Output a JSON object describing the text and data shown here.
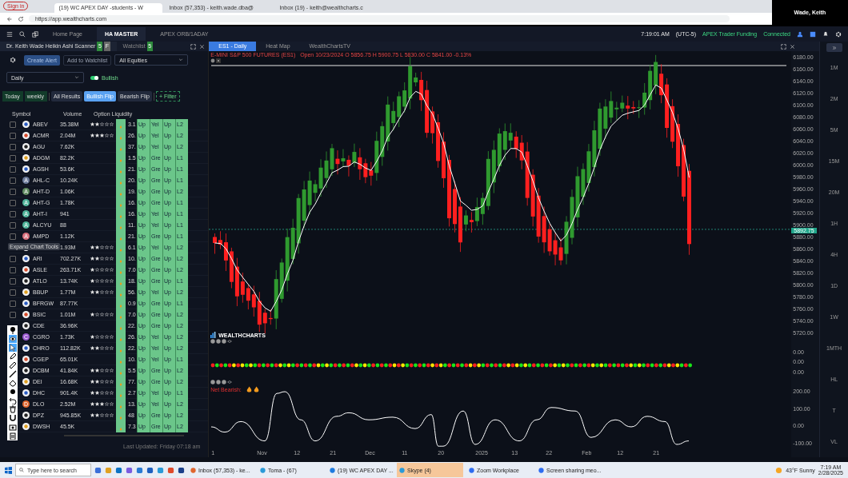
{
  "browser": {
    "sign_in": "Sign in",
    "tabs": [
      {
        "title": "(19) WC APEX DAY -students - W",
        "selected": true
      },
      {
        "title": "Inbox (57,353) - keith.wade.dba@",
        "selected": false
      },
      {
        "title": "Inbox (19) - keith@wealthcharts.c",
        "selected": false
      }
    ],
    "url": "https://app.wealthcharts.com"
  },
  "video_tile": {
    "name": "Wade, Keith"
  },
  "app_bar": {
    "tabs": [
      {
        "label": "Home Page",
        "selected": false
      },
      {
        "label": "HA MASTER",
        "selected": true
      },
      {
        "label": "APEX ORB/1ADAY",
        "selected": false
      }
    ],
    "time": "7:19:01 AM",
    "timezone": "(UTC-5)",
    "broker": "APEX Trader Funding",
    "status": "Connected"
  },
  "scanner": {
    "tabs": [
      {
        "label": "Dr. Keith Wade Heikin Ashi Scanner",
        "badges": [
          "5",
          "F"
        ],
        "selected": true
      },
      {
        "label": "Watchlist",
        "badges": [
          "5"
        ],
        "selected": false
      }
    ],
    "create_alert": "Create Alert",
    "add_watchlist": "Add to Watchlist",
    "universe": "All Equities",
    "timeframe": "Daily",
    "bullish": {
      "label": "Bullish",
      "on": true
    },
    "chips": [
      "Today",
      "weekly"
    ],
    "filters": [
      {
        "label": "All Results",
        "selected": false
      },
      {
        "label": "Bullish Flip",
        "selected": true
      },
      {
        "label": "Bearish Flip",
        "selected": false
      }
    ],
    "add_filter": "+ Filter",
    "columns": [
      "Symbol",
      "Volume",
      "Option Liquidity"
    ],
    "rows": [
      {
        "checked": false,
        "symbol": "ABEV",
        "volume": "35.38M",
        "stars": 2,
        "cells": [
          "3.1",
          "Up",
          "Yel",
          "Up",
          "L2"
        ]
      },
      {
        "checked": false,
        "symbol": "ACMR",
        "volume": "2.04M",
        "stars": 3,
        "cells": [
          "26.",
          "Up",
          "Yel",
          "Up",
          "L2"
        ]
      },
      {
        "checked": false,
        "symbol": "AGU",
        "volume": "7.62K",
        "cells": [
          "37.",
          "Up",
          "Yel",
          "Up",
          "L2"
        ]
      },
      {
        "checked": false,
        "symbol": "ADGM",
        "volume": "82.2K",
        "cells": [
          "1.5",
          "Up",
          "Gre",
          "Up",
          "L1"
        ]
      },
      {
        "checked": false,
        "symbol": "AGSH",
        "volume": "53.6K",
        "cells": [
          "21.",
          "Up",
          "Gre",
          "Up",
          "L1"
        ]
      },
      {
        "checked": false,
        "symbol": "AHL-C",
        "volume": "10.24K",
        "avatar": "A",
        "color": "#6b7a99",
        "cells": [
          "20.",
          "Up",
          "Gre",
          "Up",
          "L1"
        ]
      },
      {
        "checked": false,
        "symbol": "AHT-D",
        "volume": "1.06K",
        "avatar": "A",
        "color": "#5f8a5f",
        "cells": [
          "19.",
          "Up",
          "Gre",
          "Up",
          "L2"
        ]
      },
      {
        "checked": false,
        "symbol": "AHT-G",
        "volume": "1.78K",
        "avatar": "A",
        "color": "#4fb39a",
        "cells": [
          "16.",
          "Up",
          "Gre",
          "Up",
          "L1"
        ]
      },
      {
        "checked": false,
        "symbol": "AHT-I",
        "volume": "941",
        "avatar": "A",
        "color": "#4fb39a",
        "cells": [
          "16.",
          "Up",
          "Yel",
          "Up",
          "L1"
        ]
      },
      {
        "checked": false,
        "symbol": "ALCYU",
        "volume": "88",
        "avatar": "A",
        "color": "#4fb39a",
        "cells": [
          "11.",
          "Up",
          "Yel",
          "Up",
          "L1"
        ]
      },
      {
        "checked": false,
        "symbol": "AMPD",
        "volume": "1.12K",
        "avatar": "A",
        "color": "#d9707e",
        "cells": [
          "21.",
          "Up",
          "Gre",
          "Up",
          "L1"
        ]
      },
      {
        "volume": "1.93M",
        "stars": 2,
        "cells": [
          "6.1",
          "Up",
          "Yel",
          "Up",
          "L2"
        ]
      },
      {
        "checked": false,
        "symbol": "ARI",
        "volume": "702.27K",
        "stars": 2,
        "cells": [
          "10.",
          "Up",
          "Gre",
          "Up",
          "L2"
        ]
      },
      {
        "checked": false,
        "symbol": "ASLE",
        "volume": "263.71K",
        "stars": 1,
        "cells": [
          "7.0",
          "Up",
          "Gre",
          "Up",
          "L2"
        ]
      },
      {
        "checked": false,
        "symbol": "ATLO",
        "volume": "13.74K",
        "stars": 1,
        "cells": [
          "18.",
          "Up",
          "Gre",
          "Up",
          "L1"
        ]
      },
      {
        "checked": false,
        "symbol": "BBUP",
        "volume": "1.77M",
        "stars": 2,
        "cells": [
          "56.",
          "Up",
          "Yel",
          "Up",
          "L2"
        ]
      },
      {
        "checked": false,
        "symbol": "BFRGW",
        "volume": "87.77K",
        "cells": [
          "0.9",
          "Up",
          "Gre",
          "Up",
          "L1"
        ]
      },
      {
        "checked": false,
        "symbol": "BSIC",
        "volume": "1.01M",
        "stars": 1,
        "cells": [
          "7.0",
          "Up",
          "Gre",
          "Up",
          "L2"
        ]
      },
      {
        "symbol": "CDE",
        "volume": "36.96K",
        "cells": [
          "22.",
          "Up",
          "Gre",
          "Up",
          "L2"
        ]
      },
      {
        "symbol": "CGRO",
        "volume": "1.73K",
        "stars": 1,
        "avatar": "C",
        "color": "#9b59d0",
        "cells": [
          "26.",
          "Up",
          "Yel",
          "Up",
          "L2"
        ]
      },
      {
        "symbol": "CHRO",
        "volume": "112.82K",
        "stars": 2,
        "cells": [
          "22.",
          "Up",
          "Yel",
          "Up",
          "L2"
        ]
      },
      {
        "symbol": "CGEP",
        "volume": "65.01K",
        "cells": [
          "10.",
          "Up",
          "Yel",
          "Up",
          "L1"
        ]
      },
      {
        "symbol": "DCBM",
        "volume": "41.84K",
        "stars": 2,
        "cells": [
          "5.5",
          "Up",
          "Gre",
          "Up",
          "L2"
        ]
      },
      {
        "symbol": "DEI",
        "volume": "16.68K",
        "stars": 2,
        "cells": [
          "77.",
          "Up",
          "Gre",
          "Up",
          "L2"
        ]
      },
      {
        "symbol": "DHC",
        "volume": "901.4K",
        "stars": 2,
        "cells": [
          "2.7",
          "Up",
          "Yel",
          "Up",
          "L1"
        ]
      },
      {
        "symbol": "DLO",
        "volume": "2.52M",
        "stars": 3,
        "avatar": "D",
        "color": "#e0662e",
        "cells": [
          "13.",
          "Up",
          "Yel",
          "Up",
          "L2"
        ]
      },
      {
        "symbol": "DPZ",
        "volume": "945.85K",
        "stars": 2,
        "cells": [
          "48",
          "Up",
          "Gre",
          "Up",
          "L2"
        ]
      },
      {
        "symbol": "DWSH",
        "volume": "45.5K",
        "cells": [
          "7.3",
          "Up",
          "Gre",
          "Up",
          "L2"
        ]
      }
    ],
    "last_updated": "Last Updated: Friday 07:18 am"
  },
  "chart": {
    "tabs": [
      {
        "label": "ES1 - Daily",
        "selected": true
      },
      {
        "label": "Heat Map",
        "selected": false
      },
      {
        "label": "WealthChartsTV",
        "selected": false
      }
    ],
    "legend": "E-MINI S&P 500 FUTURES (ES1)   Open 10/23/2024 O 5856.75 H 5900.75 L 5830.00 C 5841.00 -0.13%",
    "price_labels": [
      "6180.00",
      "6160.00",
      "6140.00",
      "6120.00",
      "6100.00",
      "6080.00",
      "6060.00",
      "6040.00",
      "6020.00",
      "6000.00",
      "5980.00",
      "5960.00",
      "5940.00",
      "5920.00",
      "5900.00",
      "5880.00",
      "5860.00",
      "5840.00",
      "5820.00",
      "5800.00",
      "5780.00",
      "5760.00",
      "5740.00",
      "5720.00"
    ],
    "last_price": "5892.75",
    "logo": "WEALTHCHARTS",
    "dot_labels": [
      "0.00",
      "0.00",
      "0.00"
    ],
    "signal": "Net Bearish:",
    "osc_labels": [
      "200.00",
      "100.00",
      "0.00",
      "-100.00"
    ],
    "x_labels": [
      "1",
      "Nov",
      "12",
      "21",
      "Dec",
      "11",
      "20",
      "2025",
      "13",
      "22",
      "Feb",
      "12",
      "21"
    ]
  },
  "timeframes": [
    "1M",
    "2M",
    "5M",
    "15M",
    "20M",
    "1H",
    "4H",
    "1D",
    "1W",
    "1MTH",
    "HL",
    "T",
    "VL"
  ],
  "tooltip": "Expand Chart Tools",
  "taskbar": {
    "search": "Type here to search",
    "apps": [
      {
        "label": "Inbox (57,353) - ke...",
        "selected": false
      },
      {
        "label": "Toma - (67)",
        "selected": false
      },
      {
        "label": "(19) WC APEX DAY ...",
        "selected": false
      },
      {
        "label": "Skype (4)",
        "selected": true
      },
      {
        "label": "Zoom Workplace",
        "selected": false
      },
      {
        "label": "Screen sharing meo...",
        "selected": false
      }
    ],
    "weather": "43°F  Sunny",
    "time": "7:19 AM",
    "date": "2/28/2025"
  }
}
